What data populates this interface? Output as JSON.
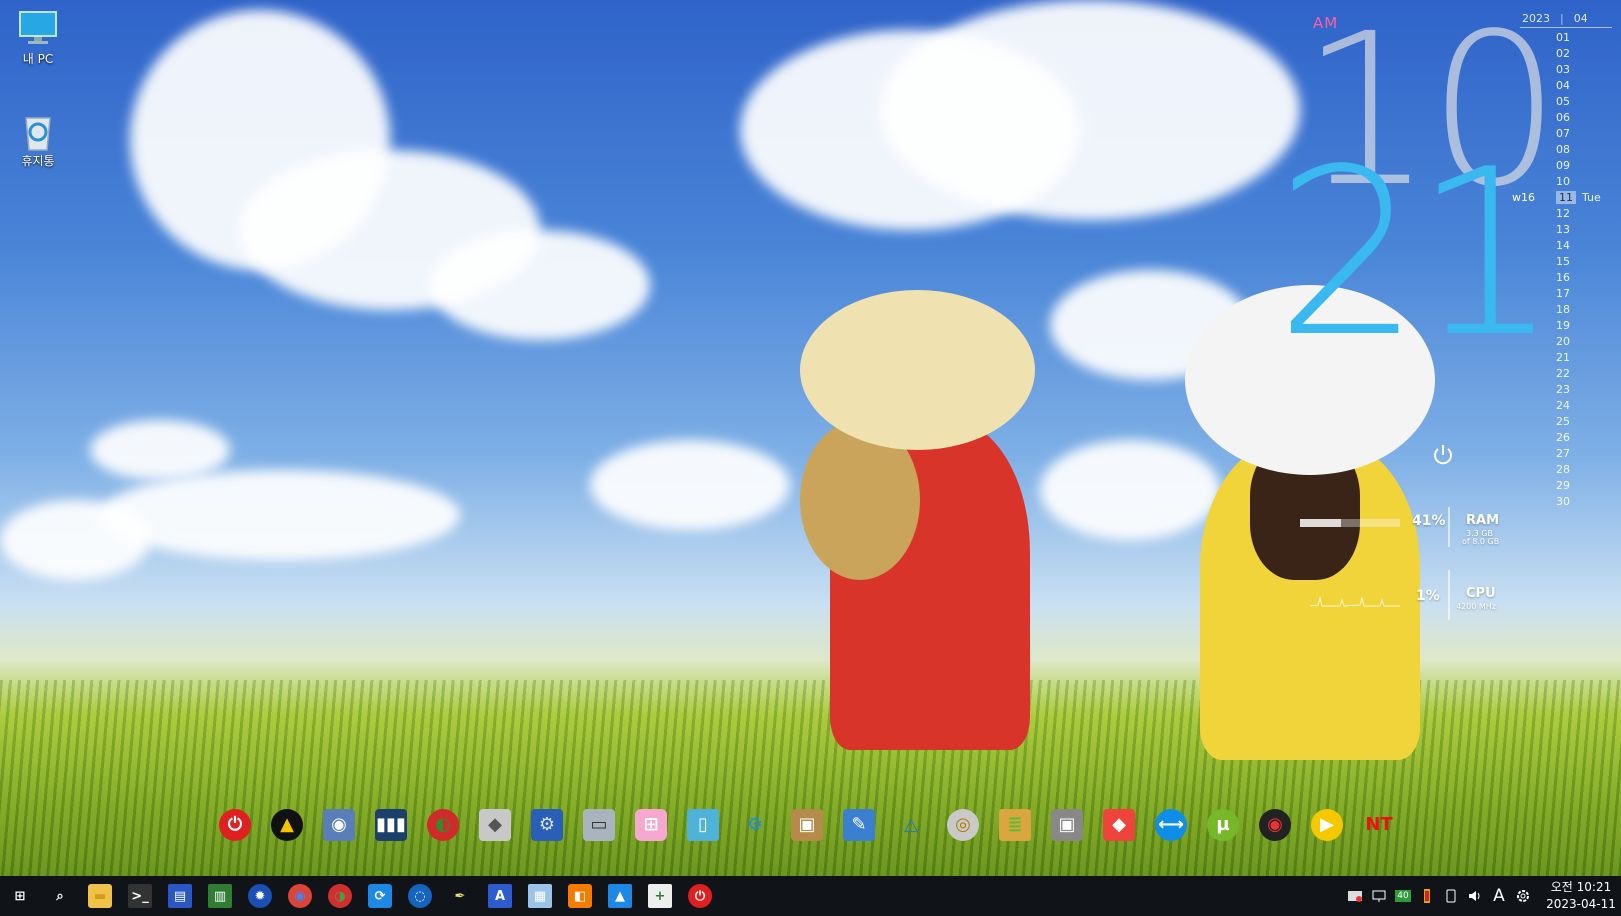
{
  "desktop": {
    "icons": [
      {
        "label": "내 PC",
        "icon": "computer-icon"
      },
      {
        "label": "휴지통",
        "icon": "recycle-bin-icon"
      }
    ]
  },
  "clock_widget": {
    "ampm": "AM",
    "hour": "10",
    "minute": "21"
  },
  "calendar": {
    "year": "2023",
    "month": "04",
    "days": [
      "01",
      "02",
      "03",
      "04",
      "05",
      "06",
      "07",
      "08",
      "09",
      "10",
      "11",
      "12",
      "13",
      "14",
      "15",
      "16",
      "17",
      "18",
      "19",
      "20",
      "21",
      "22",
      "23",
      "24",
      "25",
      "26",
      "27",
      "28",
      "29",
      "30"
    ],
    "today": "11",
    "week": "w16",
    "weekday": "Tue"
  },
  "meters": {
    "ram": {
      "percent": "41%",
      "name": "RAM",
      "used": "3.3 GB",
      "total": "of 8.0 GB",
      "fraction": 0.41
    },
    "cpu": {
      "percent": "1%",
      "name": "CPU",
      "freq": "4200 MHz",
      "fraction": 0.01
    }
  },
  "dock": {
    "apps": [
      "power-icon",
      "aimp-icon",
      "disk-icon",
      "equalizer-icon",
      "partition-icon",
      "usb-drive-icon",
      "network-settings-icon",
      "hdd-icon",
      "windows-store-icon",
      "notepad-icon",
      "gears-icon",
      "archive-icon",
      "tools-icon",
      "triangle-app-icon",
      "disc-icon",
      "book-stack-icon",
      "camera-icon",
      "anydesk-icon",
      "teamviewer-icon",
      "utorrent-icon",
      "media-disc-icon",
      "play-icon",
      "nt-password-icon"
    ]
  },
  "taskbar": {
    "apps": [
      "start-icon",
      "search-icon",
      "file-explorer-icon",
      "terminal-icon",
      "save-icon",
      "memory-card-icon",
      "network-globe-icon",
      "chrome-icon",
      "partition-wizard-icon",
      "sync-icon",
      "browser-icon",
      "feather-icon",
      "font-app-icon",
      "registry-icon",
      "office-icon",
      "photos-icon",
      "install-icon",
      "shutdown-icon"
    ],
    "tray": [
      "warning-icon",
      "network-tray-icon",
      "battery-badge-icon",
      "usb-tray-icon",
      "volume-icon",
      "ime-icon",
      "settings-gear-icon"
    ],
    "tray_badge": "40",
    "ime_label": "A",
    "clock_time": "오전 10:21",
    "clock_date": "2023-04-11"
  }
}
